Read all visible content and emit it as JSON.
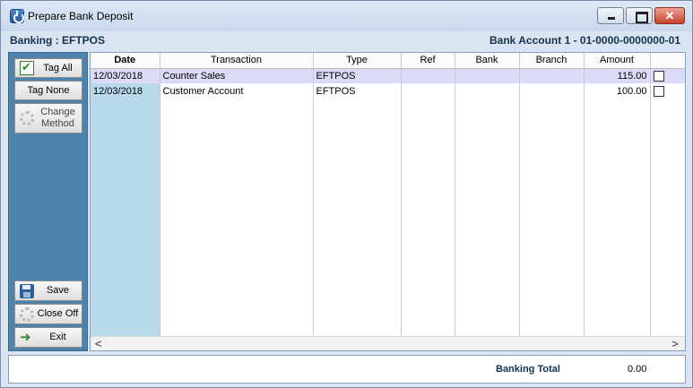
{
  "window": {
    "title": "Prepare Bank Deposit",
    "controls": {
      "minimize": "minimize",
      "maximize": "maximize",
      "close": "✕"
    }
  },
  "header": {
    "left": "Banking : EFTPOS",
    "right": "Bank Account 1 - 01-0000-0000000-01"
  },
  "sidebar": {
    "tag_all": "Tag All",
    "tag_none": "Tag None",
    "change_method_line1": "Change",
    "change_method_line2": "Method",
    "save": "Save",
    "close_off": "Close Off",
    "exit": "Exit"
  },
  "grid": {
    "columns": [
      "Date",
      "Transaction",
      "Type",
      "Ref",
      "Bank",
      "Branch",
      "Amount",
      ""
    ],
    "rows": [
      {
        "date": "12/03/2018",
        "transaction": "Counter Sales",
        "type": "EFTPOS",
        "ref": "",
        "bank": "",
        "branch": "",
        "amount": "115.00",
        "tagged": false
      },
      {
        "date": "12/03/2018",
        "transaction": "Customer Account",
        "type": "EFTPOS",
        "ref": "",
        "bank": "",
        "branch": "",
        "amount": "100.00",
        "tagged": false
      }
    ]
  },
  "scroll": {
    "left": "<",
    "right": ">"
  },
  "footer": {
    "total_label": "Banking Total",
    "total_value": "0.00"
  },
  "colors": {
    "sidebar_bg": "#4d83af",
    "date_column": "#b8d9ea",
    "selected_row": "#dcdbf7",
    "header_text": "#15324f"
  }
}
